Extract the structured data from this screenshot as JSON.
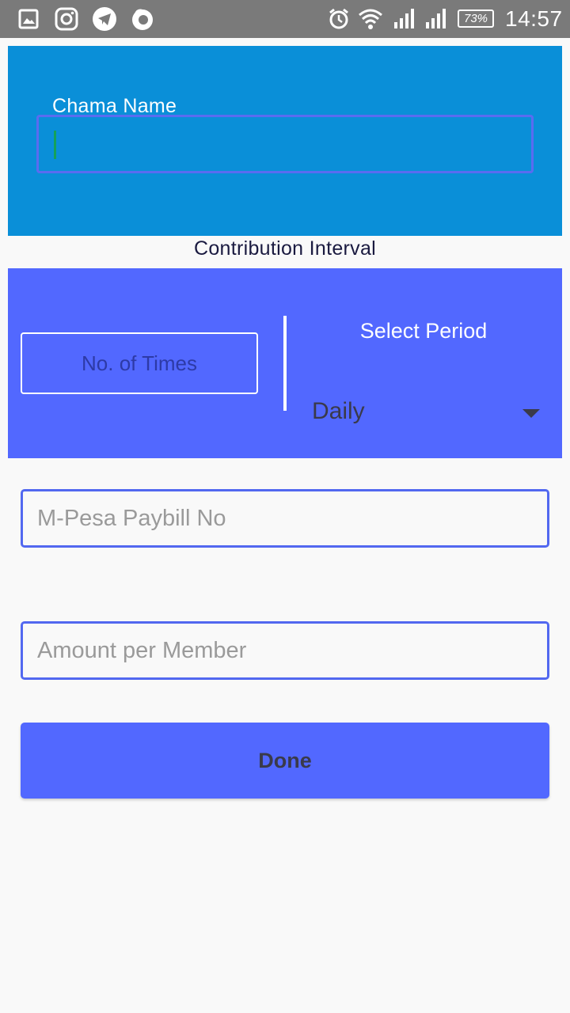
{
  "status_bar": {
    "icons": [
      "gallery-icon",
      "instagram-icon",
      "telegram-icon",
      "firefox-icon",
      "alarm-icon",
      "wifi-icon",
      "signal-icon",
      "signal-icon"
    ],
    "battery": "73%",
    "time": "14:57"
  },
  "form": {
    "chama_name_label": "Chama Name",
    "chama_name_value": "",
    "contribution_interval_title": "Contribution Interval",
    "times_placeholder": "No. of Times",
    "period_label": "Select Period",
    "period_selected": "Daily",
    "paybill_placeholder": "M-Pesa Paybill No",
    "amount_placeholder": "Amount per Member",
    "done_label": "Done"
  },
  "colors": {
    "status_bar": "#7a7a7a",
    "name_panel": "#0a8fd8",
    "accent": "#5268ff",
    "background": "#f9f9f9"
  }
}
